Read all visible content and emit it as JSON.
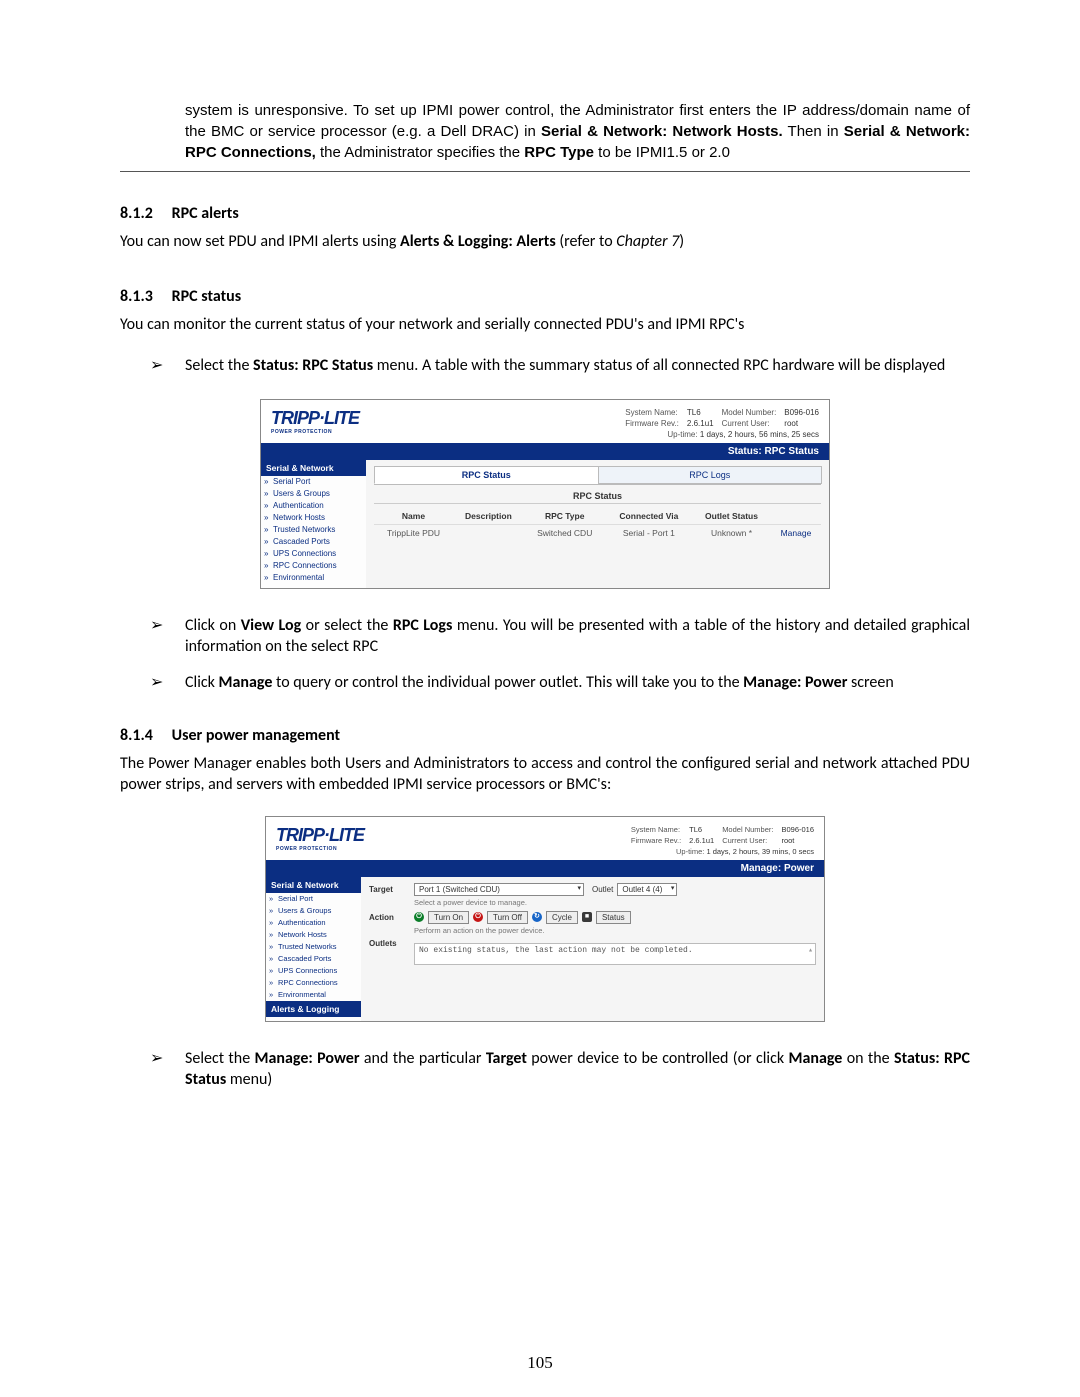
{
  "intro": {
    "t1": "system is unresponsive. To set up IPMI power control, the Administrator first enters the IP address/domain name of the BMC or service processor (e.g. a Dell DRAC) in ",
    "b1": "Serial & Network: Network Hosts.",
    "t2": " Then in ",
    "b2": "Serial & Network: RPC Connections,",
    "t3": " the Administrator specifies the ",
    "b3": "RPC Type",
    "t4": " to be IPMI1.5 or 2.0"
  },
  "sec812": {
    "num": "8.1.2",
    "title": "RPC alerts"
  },
  "sec812_body": {
    "t1": "You can now set PDU and IPMI alerts using ",
    "b1": "Alerts & Logging: Alerts",
    "t2": " (refer to ",
    "i1": "Chapter 7",
    "t3": ")"
  },
  "sec813": {
    "num": "8.1.3",
    "title": "RPC status"
  },
  "sec813_intro": "You can monitor the current status of your network and serially connected PDU's and IPMI RPC's",
  "b813_1": {
    "t1": "Select the ",
    "b1": "Status: RPC Status",
    "t2": " menu. A table with the summary status of all connected RPC hardware will be displayed"
  },
  "b813_2": {
    "t1": "Click on ",
    "b1": "View Log",
    "t2": " or select the ",
    "b2": "RPC Logs",
    "t3": " menu. You will be presented with a table of the history and detailed graphical information on the select RPC"
  },
  "b813_3": {
    "t1": "Click ",
    "b1": "Manage",
    "t2": " to query or control the individual power outlet. This will take you to the ",
    "b2": "Manage: Power",
    "t3": " screen"
  },
  "sec814": {
    "num": "8.1.4",
    "title": "User power management"
  },
  "sec814_intro": "The Power Manager enables both Users and Administrators to access and control the configured serial and network attached PDU power strips, and servers with embedded IPMI service processors or BMC's:",
  "b814_1": {
    "t1": "Select the ",
    "b1": "Manage: Power",
    "t2": " and the particular ",
    "b2": "Target",
    "t3": "  power device to be controlled (or click ",
    "b3": "Manage",
    "t4": " on the ",
    "b4": "Status: RPC Status",
    "t5": " menu)"
  },
  "shot1": {
    "logo": "TRIPP·LITE",
    "meta": {
      "l1": "System Name:",
      "v1": "TL6",
      "l2": "Model Number:",
      "v2": "B096-016",
      "l3": "Firmware Rev.:",
      "v3": "2.6.1u1",
      "l4": "Current User:",
      "v4": "root",
      "uptime_l": "Up-time:",
      "uptime_v": "1 days, 2 hours, 56 mins, 25 secs"
    },
    "bar": "Status: RPC Status",
    "sidebar": {
      "head": "Serial & Network",
      "items": [
        "Serial Port",
        "Users & Groups",
        "Authentication",
        "Network Hosts",
        "Trusted Networks",
        "Cascaded Ports",
        "UPS Connections",
        "RPC Connections",
        "Environmental"
      ]
    },
    "tabs": [
      "RPC Status",
      "RPC Logs"
    ],
    "group": "RPC Status",
    "cols": [
      "Name",
      "Description",
      "RPC Type",
      "Connected Via",
      "Outlet Status",
      ""
    ],
    "row": [
      "TrippLite PDU",
      "",
      "Switched  CDU",
      "Serial - Port 1",
      "Unknown *",
      "Manage"
    ]
  },
  "shot2": {
    "logo": "TRIPP·LITE",
    "meta": {
      "l1": "System Name:",
      "v1": "TL6",
      "l2": "Model Number:",
      "v2": "B096-016",
      "l3": "Firmware Rev.:",
      "v3": "2.6.1u1",
      "l4": "Current User:",
      "v4": "root",
      "uptime_l": "Up-time:",
      "uptime_v": "1 days, 2 hours, 39 mins, 0 secs"
    },
    "bar": "Manage: Power",
    "sidebar": {
      "head": "Serial & Network",
      "items": [
        "Serial Port",
        "Users & Groups",
        "Authentication",
        "Network Hosts",
        "Trusted Networks",
        "Cascaded Ports",
        "UPS Connections",
        "RPC Connections",
        "Environmental"
      ],
      "foot": "Alerts & Logging"
    },
    "form": {
      "target_l": "Target",
      "target_v": "Port 1 (Switched CDU)",
      "target_hint": "Select a power device to manage.",
      "outlet_l": "Outlet",
      "outlet_v": "Outlet 4 (4)",
      "action_l": "Action",
      "action_hint": "Perform an action on the power device.",
      "buttons": [
        "Turn On",
        "Turn Off",
        "Cycle",
        "Status"
      ],
      "outlets_l": "Outlets",
      "outlets_msg": "No existing status, the last action may not be completed."
    }
  },
  "page_number": "105"
}
